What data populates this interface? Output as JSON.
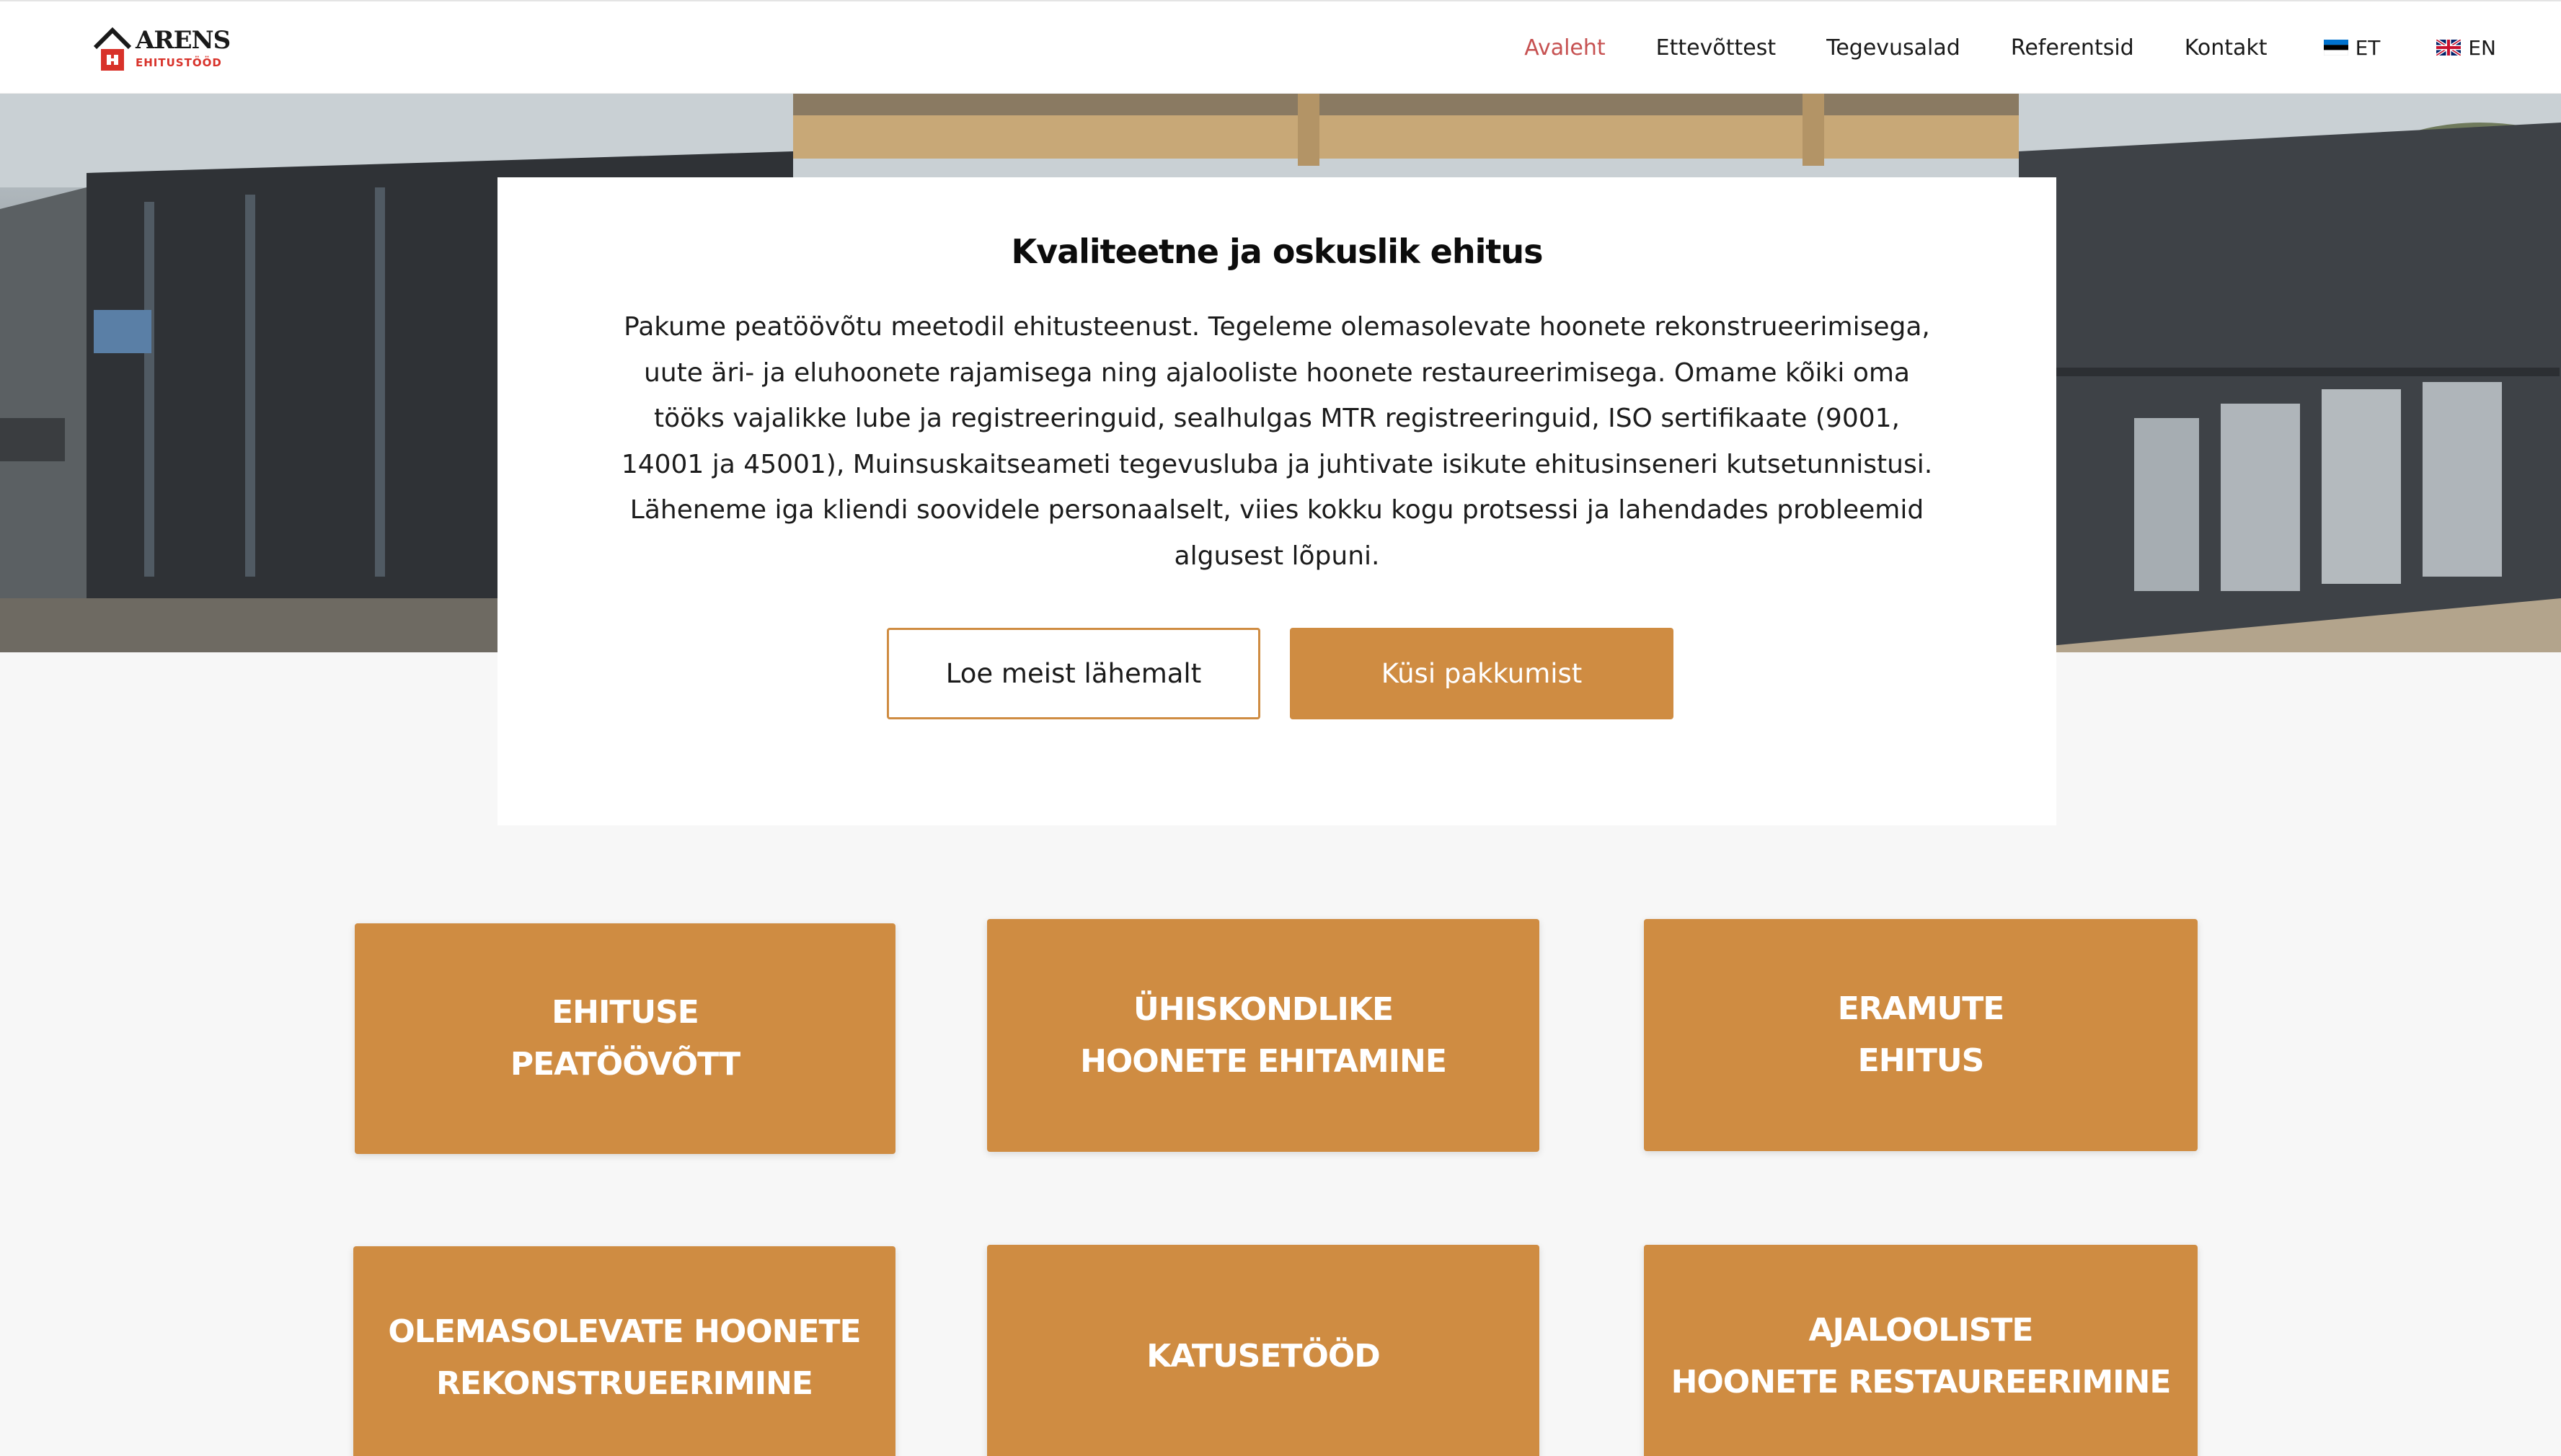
{
  "header": {
    "logo": {
      "name": "ARENS",
      "subtitle": "EHITUSTÖÖD"
    },
    "nav": [
      {
        "label": "Avaleht",
        "active": true
      },
      {
        "label": "Ettevõttest",
        "active": false
      },
      {
        "label": "Tegevusalad",
        "active": false
      },
      {
        "label": "Referentsid",
        "active": false
      },
      {
        "label": "Kontakt",
        "active": false
      }
    ],
    "languages": [
      {
        "code": "ET",
        "flag": "estonia-flag"
      },
      {
        "code": "EN",
        "flag": "uk-flag"
      }
    ]
  },
  "intro": {
    "title": "Kvaliteetne ja oskuslik ehitus",
    "text": "Pakume peatöövõtu meetodil ehitusteenust. Tegeleme olemasolevate hoonete rekonstrueerimisega, uute äri- ja eluhoonete rajamisega ning ajalooliste hoonete restaureerimisega. Omame kõiki oma tööks vajalikke lube ja registreeringuid, sealhulgas MTR registreeringuid, ISO sertifikaate (9001, 14001 ja 45001), Muinsuskaitseameti tegevusluba ja juhtivate isikute ehitusinseneri kutsetunnistusi. Läheneme iga kliendi soovidele personaalselt, viies kokku kogu protsessi ja lahendades probleemid algusest lõpuni.",
    "button_more": "Loe meist lähemalt",
    "button_quote": "Küsi pakkumist"
  },
  "services": [
    "EHITUSE\nPEATÖÖVÕTT",
    "ÜHISKONDLIKE\nHOONETE EHITAMINE",
    "ERAMUTE\nEHITUS",
    "OLEMASOLEVATE HOONETE\nREKONSTRUEERIMINE",
    "KATUSETÖÖD",
    "AJALOOLISTE\nHOONETE RESTAUREERIMINE"
  ],
  "colors": {
    "accent": "#cf8c42",
    "nav_active": "#c65151",
    "logo_red": "#d8322a",
    "background": "#f7f7f7"
  }
}
